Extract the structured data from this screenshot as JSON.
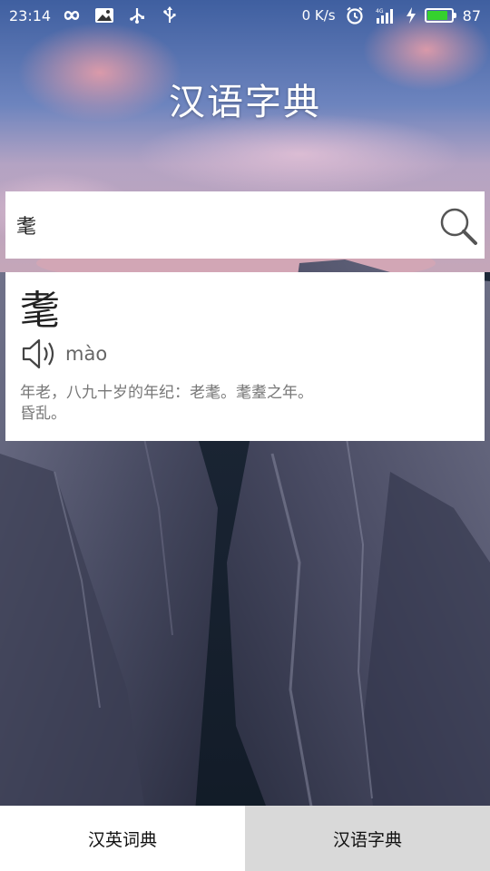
{
  "status_bar": {
    "time": "23:14",
    "net_speed": "0 K/s",
    "battery_level": "87",
    "battery_fraction": 0.87,
    "battery_color": "#35d12e",
    "left_icons": [
      "infinity-icon",
      "image-notification-icon",
      "usb-icon",
      "usb-debug-icon"
    ],
    "right_icons": [
      "alarm-icon",
      "signal-4g-icon",
      "charging-icon",
      "battery-icon"
    ]
  },
  "app": {
    "title": "汉语字典"
  },
  "search": {
    "value": "耄",
    "placeholder": ""
  },
  "result": {
    "character": "耄",
    "pinyin": "mào",
    "definition_lines": [
      "年老，八九十岁的年纪：老耄。耄耋之年。",
      "昏乱。"
    ]
  },
  "tabs": [
    {
      "label": "汉英词典",
      "active": false
    },
    {
      "label": "汉语字典",
      "active": true
    }
  ],
  "colors": {
    "active_tab_bg": "#d9d9d9",
    "inactive_tab_bg": "#ffffff"
  }
}
